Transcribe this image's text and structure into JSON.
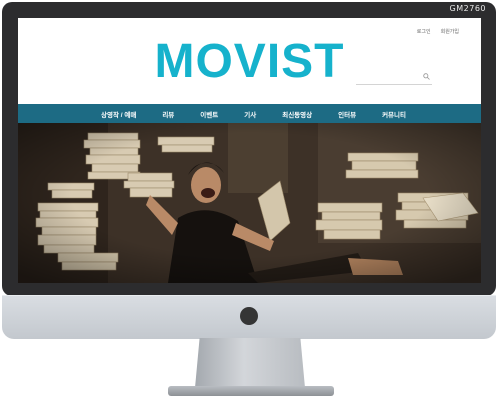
{
  "monitor": {
    "model_tag": "GM2760"
  },
  "site": {
    "logo": "MOVIST",
    "util_links": [
      "로그인",
      "회원가입"
    ],
    "search": {
      "placeholder": ""
    },
    "nav": [
      "상영작 / 예매",
      "리뷰",
      "이벤트",
      "기사",
      "최신동영상",
      "인터뷰",
      "커뮤니티"
    ],
    "colors": {
      "logo": "#16b2cc",
      "nav_bg": "#1d6b84",
      "bezel": "#2c2c2e"
    }
  },
  "hero": {
    "description_icon": "movie-still-image"
  }
}
